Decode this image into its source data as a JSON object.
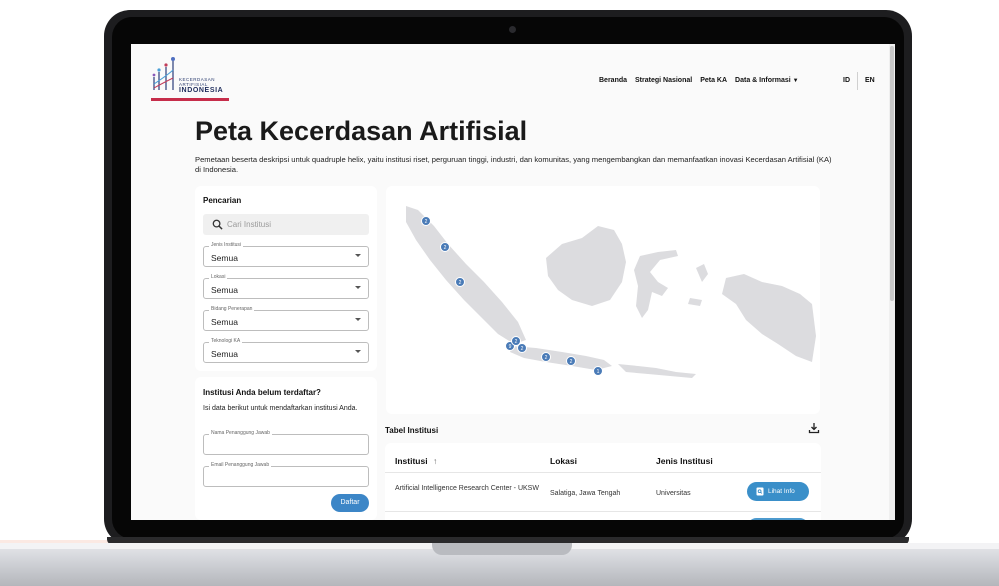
{
  "logo": {
    "line1": "KECERDASAN",
    "line2": "ARTIFISIAL",
    "line3": "INDONESIA"
  },
  "nav": {
    "items": [
      "Beranda",
      "Strategi Nasional",
      "Peta KA",
      "Data & Informasi"
    ],
    "lang": [
      "ID",
      "EN"
    ]
  },
  "page": {
    "title": "Peta Kecerdasan Artifisial",
    "description": "Pemetaan beserta deskripsi untuk quadruple helix, yaitu institusi riset, perguruan tinggi, industri, dan komunitas, yang mengembangkan dan memanfaatkan inovasi Kecerdasan Artifisial (KA) di Indonesia."
  },
  "search": {
    "title": "Pencarian",
    "placeholder": "Cari Institusi",
    "filters": [
      {
        "label": "Jenis Institusi",
        "value": "Semua"
      },
      {
        "label": "Lokasi",
        "value": "Semua"
      },
      {
        "label": "Bidang Penerapan",
        "value": "Semua"
      },
      {
        "label": "Teknologi KA",
        "value": "Semua"
      }
    ]
  },
  "register": {
    "title": "Institusi Anda belum terdaftar?",
    "description": "Isi data berikut untuk mendaftarkan institusi Anda.",
    "name_label": "Nama Penanggung Jawab",
    "email_label": "Email Penanggung Jawab",
    "submit": "Daftar"
  },
  "map": {
    "clusters": [
      "2",
      "2",
      "2",
      "9",
      "2",
      "2",
      "2",
      "2",
      "1"
    ]
  },
  "table": {
    "title": "Tabel Institusi",
    "columns": [
      "Institusi",
      "Lokasi",
      "Jenis Institusi"
    ],
    "sort_glyph": "↑",
    "rows": [
      {
        "institusi": "Artificial Intelligence Research Center - UKSW",
        "lokasi": "Salatiga, Jawa Tengah",
        "jenis": "Universitas",
        "action": "Lihat Info"
      }
    ]
  }
}
